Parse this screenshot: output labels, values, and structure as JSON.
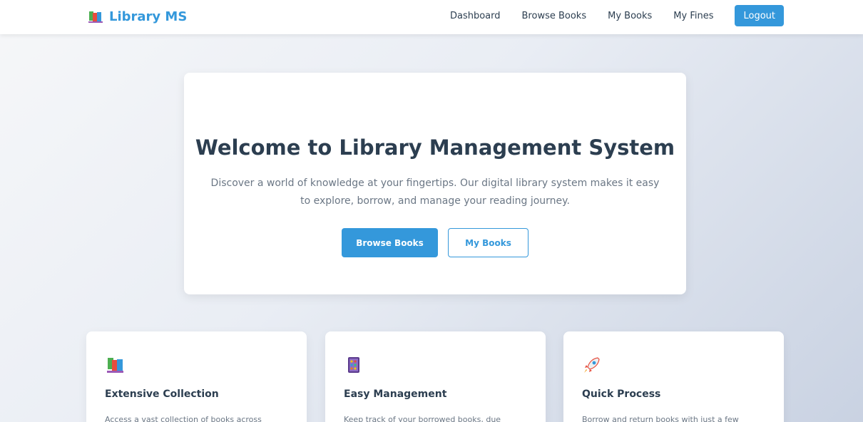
{
  "navbar": {
    "brand": "Library MS",
    "brand_icon": "books-icon",
    "links": [
      "Dashboard",
      "Browse Books",
      "My Books",
      "My Fines"
    ],
    "logout_label": "Logout"
  },
  "hero": {
    "title": "Welcome to Library Management System",
    "description": "Discover a world of knowledge at your fingertips. Our digital library system makes it easy to explore, borrow, and manage your reading journey.",
    "primary_button": "Browse Books",
    "secondary_button": "My Books"
  },
  "features": [
    {
      "icon": "books-icon",
      "title": "Extensive Collection",
      "description": "Access a vast collection of books across"
    },
    {
      "icon": "abacus-icon",
      "title": "Easy Management",
      "description": "Keep track of your borrowed books, due"
    },
    {
      "icon": "rocket-icon",
      "title": "Quick Process",
      "description": "Borrow and return books with just a few"
    }
  ],
  "colors": {
    "accent": "#3498db",
    "heading": "#2c3e50",
    "muted_text": "#6b7785"
  }
}
